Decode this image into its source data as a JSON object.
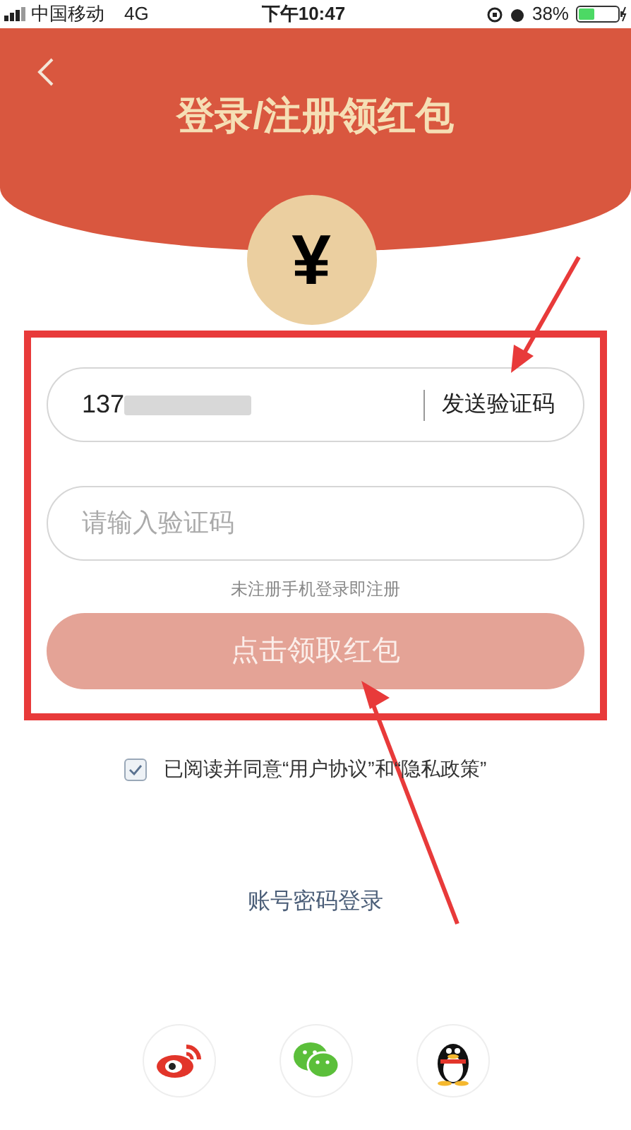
{
  "status_bar": {
    "carrier": "中国移动",
    "network": "4G",
    "time": "下午10:47",
    "battery": "38%"
  },
  "header": {
    "title": "登录/注册领红包"
  },
  "coin": {
    "symbol": "¥"
  },
  "form": {
    "phone": {
      "value": "137"
    },
    "send_code_button": "发送验证码",
    "code": {
      "placeholder": "请输入验证码"
    },
    "hint": "未注册手机登录即注册",
    "submit_button": "点击领取红包"
  },
  "agreement": {
    "checked": true,
    "text": "已阅读并同意“用户协议”和“隐私政策”"
  },
  "account_login": "账号密码登录"
}
